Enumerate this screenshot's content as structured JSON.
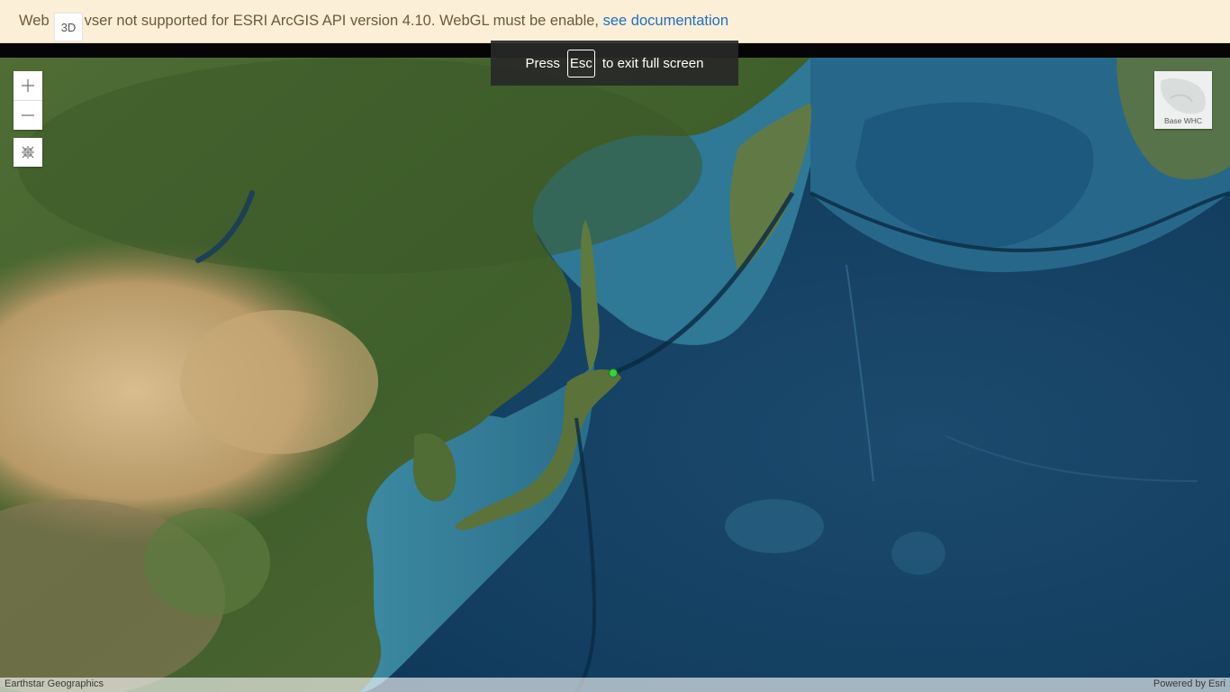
{
  "banner": {
    "message_start": "Web",
    "message_rest": "vser not supported for ESRI ArcGIS API version 4.10. WebGL must be enable, ",
    "link_label": "see documentation"
  },
  "view_toggle": {
    "label": "3D"
  },
  "fullscreen_toast": {
    "press": "Press",
    "key": "Esc",
    "suffix": "to exit full screen"
  },
  "zoom": {
    "in_icon": "plus-icon",
    "out_icon": "minus-icon"
  },
  "fullscreen_button": {
    "icon": "exit-fullscreen-icon"
  },
  "basemap_toggle": {
    "label": "Base WHC"
  },
  "attribution": {
    "left": "Earthstar Geographics",
    "right": "Powered by Esri"
  },
  "marker": {
    "color": "#35d23a"
  },
  "colors": {
    "banner_bg": "#fbefd8",
    "link": "#1f6fc2",
    "ocean_deep": "#0d3554",
    "ocean_shallow": "#3b8aa3",
    "land_green": "#4d6b34",
    "land_desert": "#c7aa7a"
  }
}
